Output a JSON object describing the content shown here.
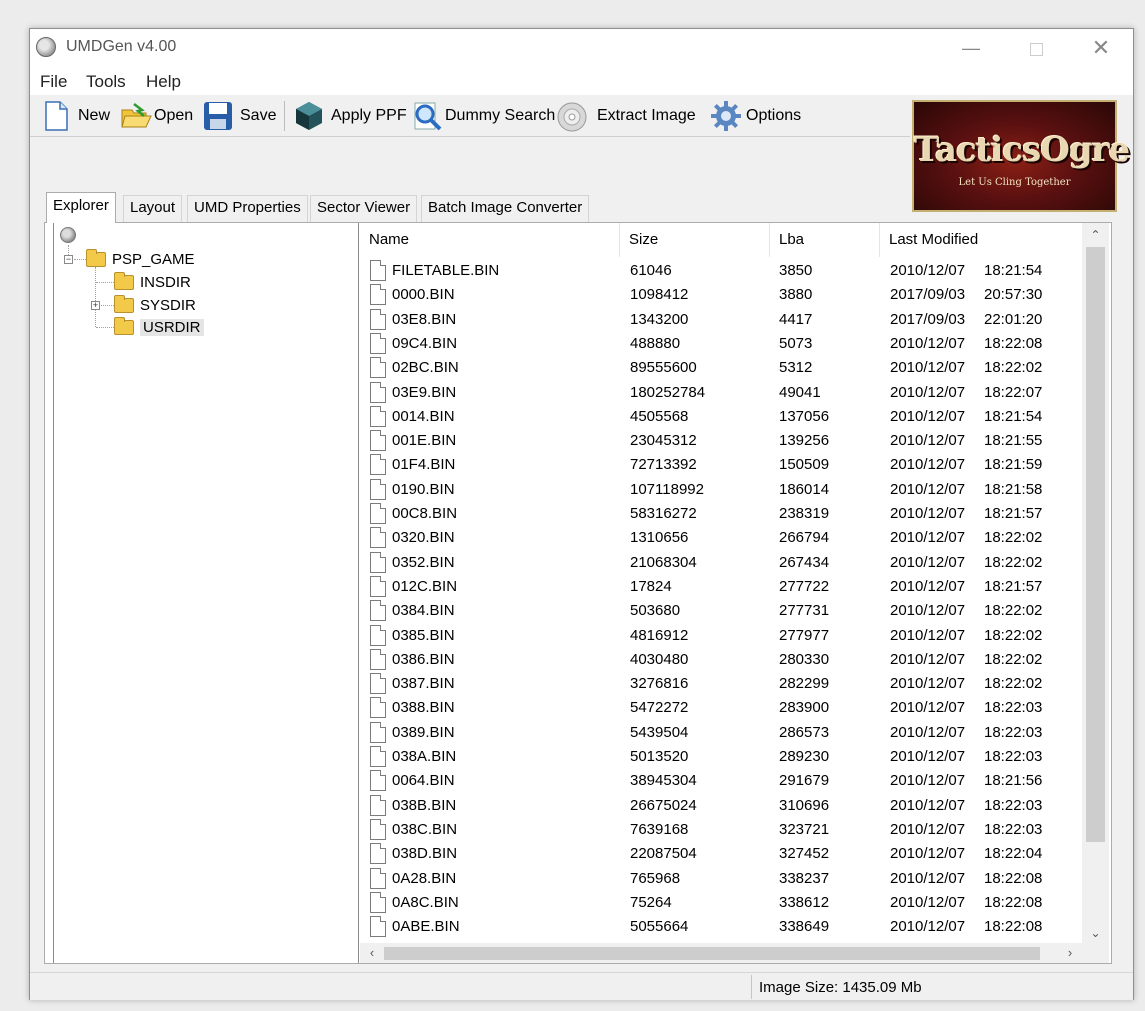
{
  "window": {
    "title": "UMDGen v4.00"
  },
  "menu": [
    "File",
    "Tools",
    "Help"
  ],
  "toolbar": {
    "new": "New",
    "open": "Open",
    "save": "Save",
    "apply_ppf": "Apply PPF",
    "dummy_search": "Dummy Search",
    "extract_image": "Extract Image",
    "options": "Options"
  },
  "logo": {
    "title": "TacticsOgre",
    "subtitle": "Let Us Cling Together"
  },
  "tabs": [
    "Explorer",
    "Layout",
    "UMD Properties",
    "Sector Viewer",
    "Batch Image Converter"
  ],
  "tree": {
    "root": "PSP_GAME",
    "children": [
      "INSDIR",
      "SYSDIR",
      "USRDIR"
    ],
    "selected": "USRDIR"
  },
  "list": {
    "columns": [
      "Name",
      "Size",
      "Lba",
      "Last Modified"
    ],
    "rows": [
      [
        "FILETABLE.BIN",
        "61046",
        "3850",
        "2010/12/07",
        "18:21:54"
      ],
      [
        "0000.BIN",
        "1098412",
        "3880",
        "2017/09/03",
        "20:57:30"
      ],
      [
        "03E8.BIN",
        "1343200",
        "4417",
        "2017/09/03",
        "22:01:20"
      ],
      [
        "09C4.BIN",
        "488880",
        "5073",
        "2010/12/07",
        "18:22:08"
      ],
      [
        "02BC.BIN",
        "89555600",
        "5312",
        "2010/12/07",
        "18:22:02"
      ],
      [
        "03E9.BIN",
        "180252784",
        "49041",
        "2010/12/07",
        "18:22:07"
      ],
      [
        "0014.BIN",
        "4505568",
        "137056",
        "2010/12/07",
        "18:21:54"
      ],
      [
        "001E.BIN",
        "23045312",
        "139256",
        "2010/12/07",
        "18:21:55"
      ],
      [
        "01F4.BIN",
        "72713392",
        "150509",
        "2010/12/07",
        "18:21:59"
      ],
      [
        "0190.BIN",
        "107118992",
        "186014",
        "2010/12/07",
        "18:21:58"
      ],
      [
        "00C8.BIN",
        "58316272",
        "238319",
        "2010/12/07",
        "18:21:57"
      ],
      [
        "0320.BIN",
        "1310656",
        "266794",
        "2010/12/07",
        "18:22:02"
      ],
      [
        "0352.BIN",
        "21068304",
        "267434",
        "2010/12/07",
        "18:22:02"
      ],
      [
        "012C.BIN",
        "17824",
        "277722",
        "2010/12/07",
        "18:21:57"
      ],
      [
        "0384.BIN",
        "503680",
        "277731",
        "2010/12/07",
        "18:22:02"
      ],
      [
        "0385.BIN",
        "4816912",
        "277977",
        "2010/12/07",
        "18:22:02"
      ],
      [
        "0386.BIN",
        "4030480",
        "280330",
        "2010/12/07",
        "18:22:02"
      ],
      [
        "0387.BIN",
        "3276816",
        "282299",
        "2010/12/07",
        "18:22:02"
      ],
      [
        "0388.BIN",
        "5472272",
        "283900",
        "2010/12/07",
        "18:22:03"
      ],
      [
        "0389.BIN",
        "5439504",
        "286573",
        "2010/12/07",
        "18:22:03"
      ],
      [
        "038A.BIN",
        "5013520",
        "289230",
        "2010/12/07",
        "18:22:03"
      ],
      [
        "0064.BIN",
        "38945304",
        "291679",
        "2010/12/07",
        "18:21:56"
      ],
      [
        "038B.BIN",
        "26675024",
        "310696",
        "2010/12/07",
        "18:22:03"
      ],
      [
        "038C.BIN",
        "7639168",
        "323721",
        "2010/12/07",
        "18:22:03"
      ],
      [
        "038D.BIN",
        "22087504",
        "327452",
        "2010/12/07",
        "18:22:04"
      ],
      [
        "0A28.BIN",
        "765968",
        "338237",
        "2010/12/07",
        "18:22:08"
      ],
      [
        "0A8C.BIN",
        "75264",
        "338612",
        "2010/12/07",
        "18:22:08"
      ],
      [
        "0ABE.BIN",
        "5055664",
        "338649",
        "2010/12/07",
        "18:22:08"
      ]
    ]
  },
  "status": {
    "image_size": "Image Size: 1435.09 Mb"
  },
  "colors": {
    "logo_bg": "#5a1010",
    "folder": "#f3c94a",
    "scroll_thumb": "#cdcdcd"
  }
}
